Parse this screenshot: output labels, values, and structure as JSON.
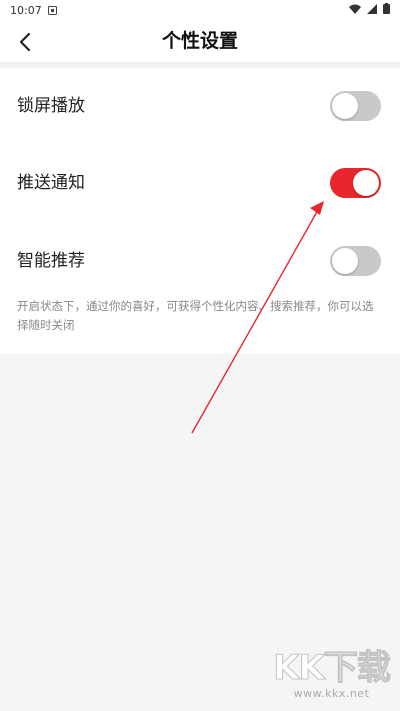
{
  "status_bar": {
    "time": "10:07",
    "left_icon": "android-notification-icon",
    "right_icons": [
      "wifi-icon",
      "signal-icon",
      "battery-icon"
    ]
  },
  "header": {
    "title": "个性设置",
    "back_icon": "chevron-left-icon"
  },
  "settings": [
    {
      "label": "锁屏播放",
      "enabled": false
    },
    {
      "label": "推送通知",
      "enabled": true
    },
    {
      "label": "智能推荐",
      "enabled": false
    }
  ],
  "hint": "开启状态下，通过你的喜好，可获得个性化内容、搜索推荐，你可以选择随时关闭",
  "annotation": {
    "color": "#e8262b"
  },
  "watermark": {
    "logo": "KK下载",
    "url": "www.kkx.net"
  },
  "colors": {
    "toggle_on": "#e8262b",
    "toggle_off": "#c9c9c9",
    "background": "#f5f5f5"
  }
}
